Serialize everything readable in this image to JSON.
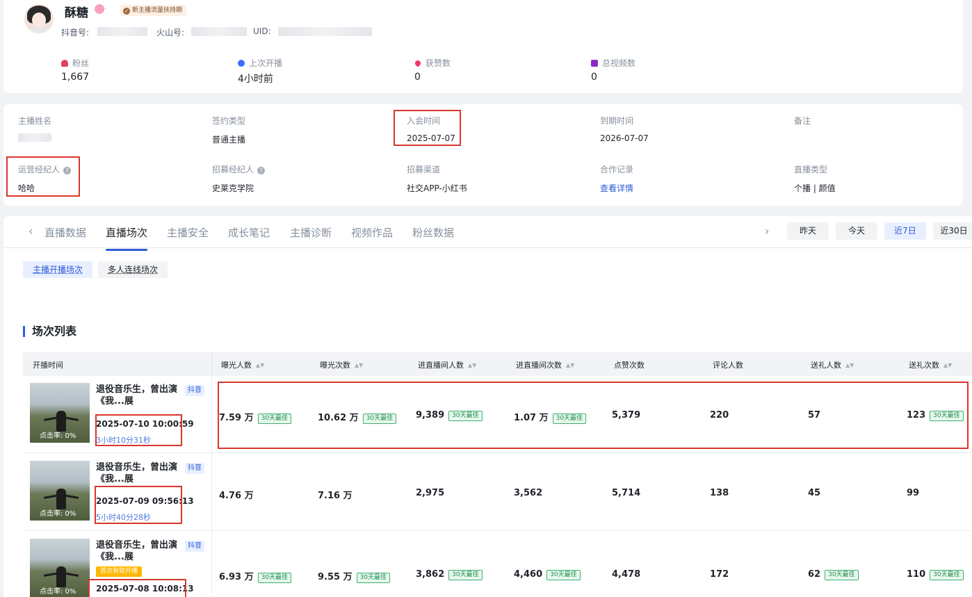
{
  "profile": {
    "name": "酥糖",
    "level_badge": "·",
    "support_badge": "新主播流量扶持期",
    "douyin_label": "抖音号:",
    "huoshan_label": "火山号:",
    "uid_label": "UID:",
    "stats": [
      {
        "label": "粉丝",
        "value": "1,667",
        "icon": "fans-icon",
        "color": "#e0415b"
      },
      {
        "label": "上次开播",
        "value": "4小时前",
        "icon": "clock-icon",
        "color": "#3d6bff"
      },
      {
        "label": "获赞数",
        "value": "0",
        "icon": "heart-icon",
        "color": "#f2356d"
      },
      {
        "label": "总视频数",
        "value": "0",
        "icon": "video-icon",
        "color": "#8c2bc9"
      }
    ]
  },
  "info": {
    "streamer_name": {
      "label": "主播姓名",
      "value": ""
    },
    "contract_type": {
      "label": "签约类型",
      "value": "普通主播"
    },
    "join_time": {
      "label": "入会时间",
      "value": "2025-07-07"
    },
    "expire_time": {
      "label": "到期时间",
      "value": "2026-07-07"
    },
    "remark": {
      "label": "备注",
      "value": ""
    },
    "ops_agent": {
      "label": "运营经纪人",
      "value": "哈哈"
    },
    "recruit_agent": {
      "label": "招募经纪人",
      "value": "史莱克学院"
    },
    "recruit_channel": {
      "label": "招募渠道",
      "value": "社交APP-小红书"
    },
    "coop_record": {
      "label": "合作记录",
      "value": "查看详情"
    },
    "live_type": {
      "label": "直播类型",
      "value": "个播 | 颜值"
    }
  },
  "tabs": [
    "直播数据",
    "直播场次",
    "主播安全",
    "成长笔记",
    "主播诊断",
    "视频作品",
    "粉丝数据"
  ],
  "active_tab": "直播场次",
  "ranges": [
    "昨天",
    "今天",
    "近7日",
    "近30日"
  ],
  "active_range": "近7日",
  "sub_tabs": [
    "主播开播场次",
    "多人连线场次"
  ],
  "section_title": "场次列表",
  "columns": [
    "开播时间",
    "曝光人数",
    "曝光次数",
    "进直播间人数",
    "进直播间次数",
    "点赞次数",
    "评论人数",
    "送礼人数",
    "送礼次数"
  ],
  "best_tag": "30天最佳",
  "sessions": [
    {
      "title": "退役音乐生，曾出演《我...展",
      "platform": "抖音",
      "ctr": "点击率: 0%",
      "first_tag": "",
      "time": "2025-07-10 10:00:59",
      "duration": "3小时10分31秒",
      "exposure_users": "7.59 万",
      "exposure_users_best": true,
      "exposure_times": "10.62 万",
      "exposure_times_best": true,
      "enter_users": "9,389",
      "enter_users_best": true,
      "enter_times": "1.07 万",
      "enter_times_best": true,
      "likes": "5,379",
      "comments": "220",
      "gift_users": "57",
      "gift_users_best": false,
      "gift_times": "123",
      "gift_times_best": true
    },
    {
      "title": "退役音乐生，曾出演《我...展",
      "platform": "抖音",
      "ctr": "点击率: 0%",
      "first_tag": "",
      "time": "2025-07-09 09:56:13",
      "duration": "5小时40分28秒",
      "exposure_users": "4.76 万",
      "exposure_users_best": false,
      "exposure_times": "7.16 万",
      "exposure_times_best": false,
      "enter_users": "2,975",
      "enter_users_best": false,
      "enter_times": "3,562",
      "enter_times_best": false,
      "likes": "5,714",
      "comments": "138",
      "gift_users": "45",
      "gift_users_best": false,
      "gift_times": "99",
      "gift_times_best": false
    },
    {
      "title": "退役音乐生，曾出演《我...展",
      "platform": "抖音",
      "ctr": "点击率: 0%",
      "first_tag": "首次有效开播",
      "time": "2025-07-08 10:08:13",
      "duration": "",
      "exposure_users": "6.93 万",
      "exposure_users_best": true,
      "exposure_times": "9.55 万",
      "exposure_times_best": true,
      "enter_users": "3,862",
      "enter_users_best": true,
      "enter_times": "4,460",
      "enter_times_best": true,
      "likes": "4,478",
      "comments": "172",
      "gift_users": "62",
      "gift_users_best": true,
      "gift_times": "110",
      "gift_times_best": true
    }
  ]
}
